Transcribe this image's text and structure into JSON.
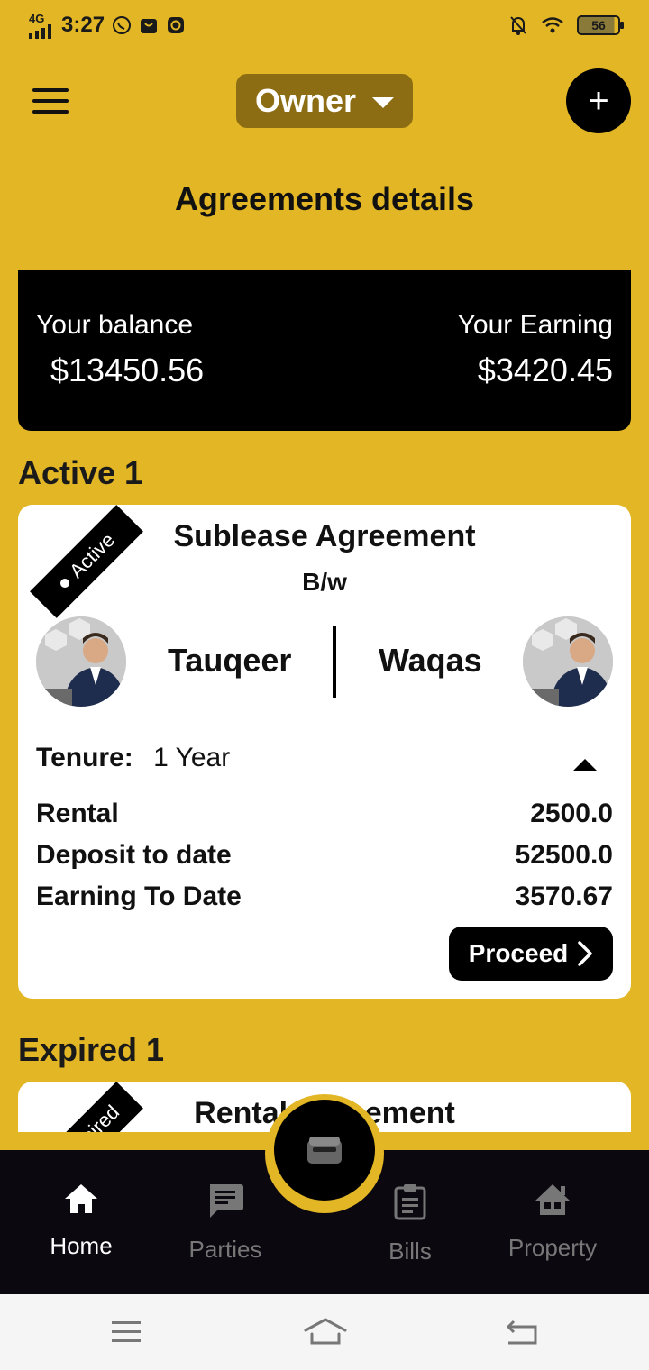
{
  "status_bar": {
    "network": "4G",
    "time": "3:27",
    "battery": "56"
  },
  "header": {
    "role": "Owner",
    "add_label": "+"
  },
  "page_title": "Agreements details",
  "balance": {
    "balance_label": "Your balance",
    "balance_value": "$13450.56",
    "earning_label": "Your Earning",
    "earning_value": "$3420.45"
  },
  "active_section": {
    "title": "Active 1",
    "card": {
      "tag": "Active",
      "title": "Sublease Agreement",
      "subtitle": "B/w",
      "party_left": "Tauqeer",
      "party_right": "Waqas",
      "tenure_label": "Tenure:",
      "tenure_value": "1 Year",
      "rows": [
        {
          "label": "Rental",
          "value": "2500.0"
        },
        {
          "label": "Deposit to date",
          "value": "52500.0"
        },
        {
          "label": "Earning To Date",
          "value": "3570.67"
        }
      ],
      "proceed_label": "Proceed"
    }
  },
  "expired_section": {
    "title": "Expired 1",
    "card": {
      "tag": "Expired",
      "title": "Rental Agreement"
    }
  },
  "bottom_nav": {
    "items": [
      {
        "label": "Home",
        "icon": "home-icon"
      },
      {
        "label": "Parties",
        "icon": "chat-icon"
      },
      {
        "label": "Bills",
        "icon": "clipboard-icon"
      },
      {
        "label": "Property",
        "icon": "property-icon"
      }
    ],
    "fab_icon": "wallet-icon"
  },
  "colors": {
    "background": "#E2B624",
    "role_select": "#8C6D14",
    "nav_background": "#0B0810",
    "card": "#FFFFFF"
  }
}
